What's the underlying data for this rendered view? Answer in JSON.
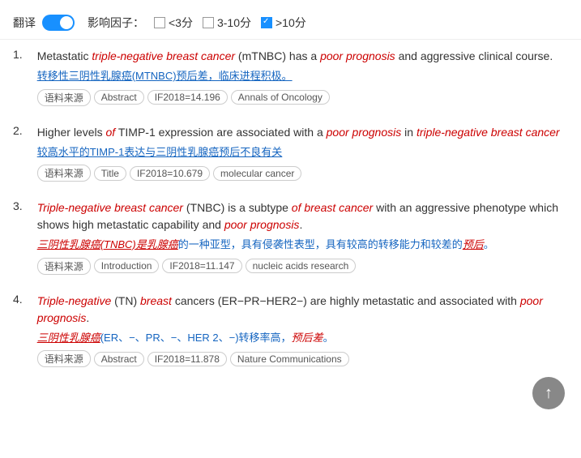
{
  "toolbar": {
    "translate_label": "翻译",
    "impact_label": "影响因子：",
    "filter1_label": "<3分",
    "filter2_label": "3-10分",
    "filter3_label": ">10分",
    "filter3_checked": true
  },
  "results": [
    {
      "number": "1.",
      "title_en_parts": [
        {
          "text": "Metastatic ",
          "style": "plain"
        },
        {
          "text": "triple-negative breast cancer",
          "style": "italic-red"
        },
        {
          "text": " (mTNBC) has a ",
          "style": "plain"
        },
        {
          "text": "poor prognosis",
          "style": "italic-red"
        },
        {
          "text": " and aggressive clinical course.",
          "style": "plain"
        }
      ],
      "title_cn_parts": [
        {
          "text": "转移性三阴性乳腺癌",
          "style": "underline-blue"
        },
        {
          "text": "(MTNBC)",
          "style": "underline-blue"
        },
        {
          "text": "预后差，",
          "style": "underline-blue"
        },
        {
          "text": "临床进程积极",
          "style": "underline-blue"
        },
        {
          "text": "。",
          "style": "plain-blue"
        }
      ],
      "tags": [
        "语料来源",
        "Abstract",
        "IF2018=14.196",
        "Annals of Oncology"
      ]
    },
    {
      "number": "2.",
      "title_en_parts": [
        {
          "text": "Higher levels ",
          "style": "plain"
        },
        {
          "text": "of",
          "style": "italic-red"
        },
        {
          "text": " TIMP-1 expression are associated with a ",
          "style": "plain"
        },
        {
          "text": "poor prognosis",
          "style": "italic-red"
        },
        {
          "text": " in ",
          "style": "plain"
        },
        {
          "text": "triple-negative breast cancer",
          "style": "italic-red"
        }
      ],
      "title_cn_parts": [
        {
          "text": "较高水平的TIMP-1表达与三阴性乳腺癌预后不良有关",
          "style": "underline-blue"
        }
      ],
      "tags": [
        "语料来源",
        "Title",
        "IF2018=10.679",
        "molecular cancer"
      ]
    },
    {
      "number": "3.",
      "title_en_parts": [
        {
          "text": "Triple-negative breast cancer",
          "style": "italic-red"
        },
        {
          "text": " (TNBC) is a subtype ",
          "style": "plain"
        },
        {
          "text": "of breast cancer",
          "style": "italic-red"
        },
        {
          "text": " with an aggressive phenotype which shows high metastatic capability and ",
          "style": "plain"
        },
        {
          "text": "poor prognosis",
          "style": "italic-red"
        },
        {
          "text": ".",
          "style": "plain"
        }
      ],
      "title_cn_parts": [
        {
          "text": "三阴性乳腺癌",
          "style": "cn-red"
        },
        {
          "text": "(TNBC)是",
          "style": "cn-red"
        },
        {
          "text": "乳腺癌",
          "style": "cn-red"
        },
        {
          "text": "的一种亚型，具有侵袭性表型，具有较高的转移能力和较差的",
          "style": "plain-blue"
        },
        {
          "text": "预后",
          "style": "cn-red"
        },
        {
          "text": "。",
          "style": "plain-blue"
        }
      ],
      "tags": [
        "语料来源",
        "Introduction",
        "IF2018=11.147",
        "nucleic acids research"
      ]
    },
    {
      "number": "4.",
      "title_en_parts": [
        {
          "text": "Triple-negative",
          "style": "italic-red"
        },
        {
          "text": " (TN) ",
          "style": "plain"
        },
        {
          "text": "breast",
          "style": "italic-red"
        },
        {
          "text": " cancers (ER−PR−HER2−) are highly metastatic and associated with ",
          "style": "plain"
        },
        {
          "text": "poor prognosis",
          "style": "italic-red"
        },
        {
          "text": ".",
          "style": "plain"
        }
      ],
      "title_cn_parts": [
        {
          "text": "三阴性乳腺癌",
          "style": "cn-red"
        },
        {
          "text": "(ER、−、PR、−、HER 2、−)转移率高，",
          "style": "plain-blue"
        },
        {
          "text": "预后差",
          "style": "cn-red"
        },
        {
          "text": "。",
          "style": "plain-blue"
        }
      ],
      "tags": [
        "语料来源",
        "Abstract",
        "IF2018=11.878",
        "Nature Communications"
      ]
    }
  ],
  "scroll_top_icon": "↑"
}
